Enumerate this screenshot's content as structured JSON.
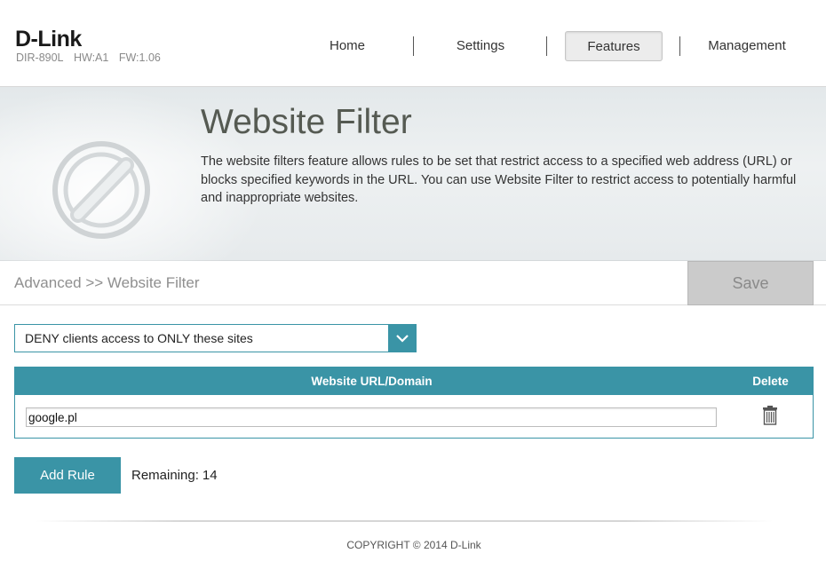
{
  "header": {
    "brand": "D-Link",
    "model": "DIR-890L",
    "hw": "HW:A1",
    "fw": "FW:1.06",
    "nav": [
      {
        "label": "Home",
        "active": false
      },
      {
        "label": "Settings",
        "active": false
      },
      {
        "label": "Features",
        "active": true
      },
      {
        "label": "Management",
        "active": false
      }
    ]
  },
  "banner": {
    "title": "Website Filter",
    "description": "The website filters feature allows rules to be set that restrict access to a specified web address (URL) or blocks specified keywords in the URL. You can use Website Filter to restrict access to potentially harmful and inappropriate websites.",
    "icon": "prohibited-icon"
  },
  "breadcrumb": "Advanced >> Website Filter",
  "save_label": "Save",
  "filter_mode": {
    "selected": "DENY clients access to ONLY these sites",
    "icon": "chevron-down-icon"
  },
  "table": {
    "col_url": "Website URL/Domain",
    "col_delete": "Delete",
    "rows": [
      {
        "url": "google.pl",
        "delete_icon": "trash-icon"
      }
    ]
  },
  "add_rule_label": "Add Rule",
  "remaining_label": "Remaining:",
  "remaining_count": "14",
  "copyright": "COPYRIGHT © 2014 D-Link",
  "colors": {
    "accent": "#3a94a6",
    "save_disabled": "#cbcbcb"
  }
}
